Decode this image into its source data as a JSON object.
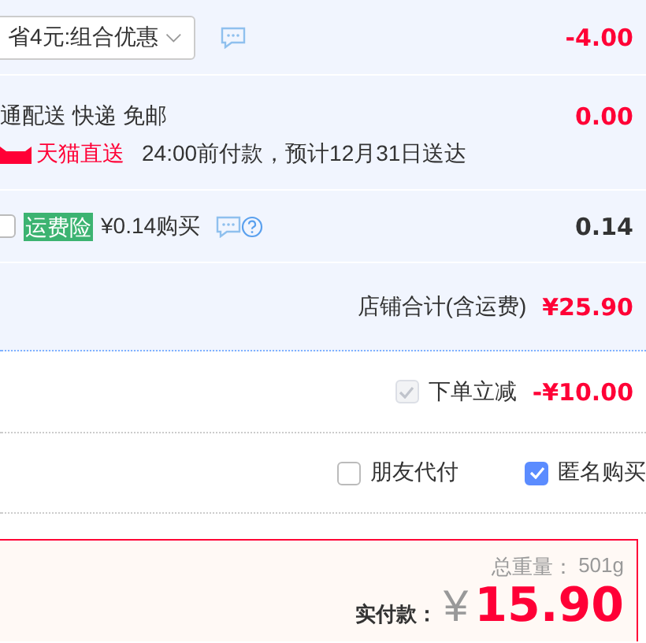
{
  "discount": {
    "select_value": "省4元:组合优惠",
    "amount": "-4.00"
  },
  "shipping": {
    "method": "通配送 快递 免邮",
    "carrier": "天猫直送",
    "eta": "24:00前付款，预计12月31日送达",
    "amount": "0.00"
  },
  "insurance": {
    "checked": false,
    "badge": "运费险",
    "price": "¥0.14购买",
    "amount": "0.14"
  },
  "store_total": {
    "label": "店铺合计(含运费)",
    "amount": "¥25.90"
  },
  "instant_discount": {
    "checked": true,
    "disabled": true,
    "label": "下单立减",
    "amount": "-¥10.00"
  },
  "options": [
    {
      "label": "朋友代付",
      "checked": false
    },
    {
      "label": "匿名购买",
      "checked": true
    }
  ],
  "summary": {
    "weight_label": "总重量：",
    "weight": "501g",
    "pay_label": "实付款：",
    "currency": "¥",
    "total": "15.90"
  }
}
